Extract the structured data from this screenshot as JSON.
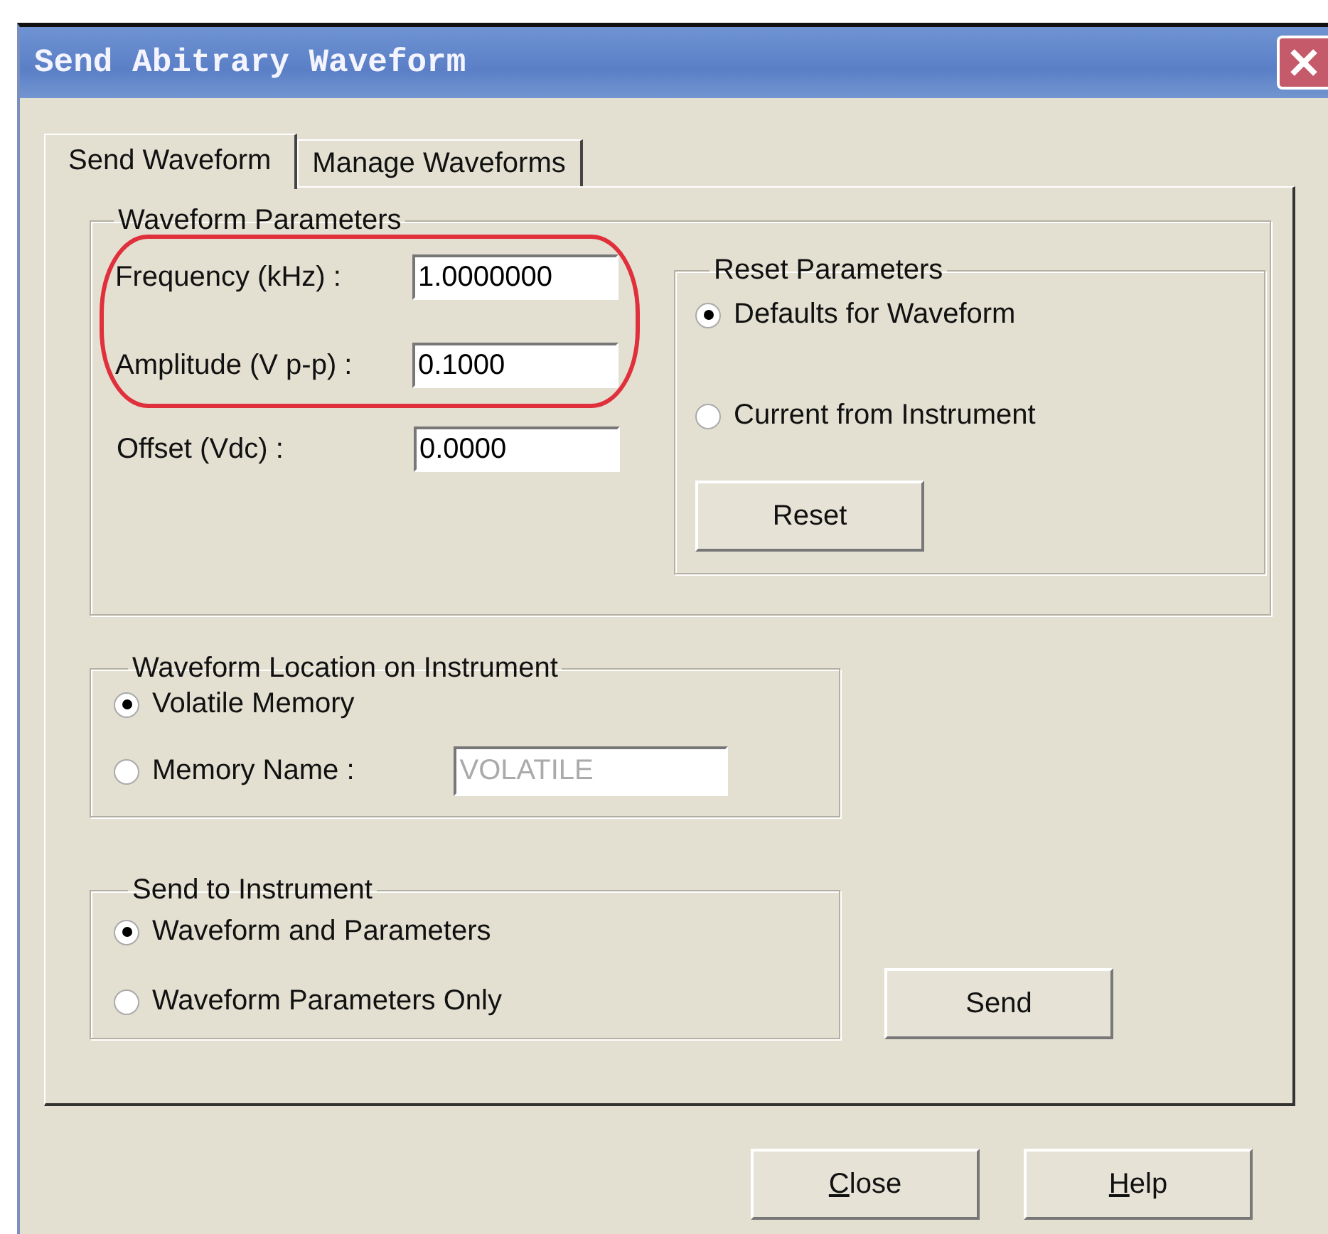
{
  "window": {
    "title": "Send Abitrary Waveform"
  },
  "tabs": [
    {
      "label": "Send Waveform",
      "selected": true
    },
    {
      "label": "Manage Waveforms",
      "selected": false
    }
  ],
  "waveform_parameters": {
    "title": "Waveform Parameters",
    "fields": [
      {
        "label": "Frequency (kHz) :",
        "value": "1.0000000",
        "highlighted": true
      },
      {
        "label": "Amplitude (V p-p) :",
        "value": "0.1000",
        "highlighted": true
      },
      {
        "label": "Offset (Vdc) :",
        "value": "0.0000",
        "highlighted": false
      }
    ]
  },
  "reset_parameters": {
    "title": "Reset Parameters",
    "options": [
      {
        "label": "Defaults for Waveform",
        "selected": true
      },
      {
        "label": "Current from Instrument",
        "selected": false
      }
    ],
    "button": "Reset"
  },
  "waveform_location": {
    "title": "Waveform Location on Instrument",
    "options": [
      {
        "label": "Volatile Memory",
        "selected": true
      },
      {
        "label": "Memory Name :",
        "selected": false
      }
    ],
    "memory_name": {
      "value": "VOLATILE",
      "disabled": true
    }
  },
  "send_to_instrument": {
    "title": "Send to Instrument",
    "options": [
      {
        "label": "Waveform and Parameters",
        "selected": true
      },
      {
        "label": "Waveform Parameters Only",
        "selected": false
      }
    ],
    "button": "Send"
  },
  "buttons": [
    {
      "access_key": "C",
      "rest": "lose"
    },
    {
      "access_key": "H",
      "rest": "elp"
    }
  ]
}
